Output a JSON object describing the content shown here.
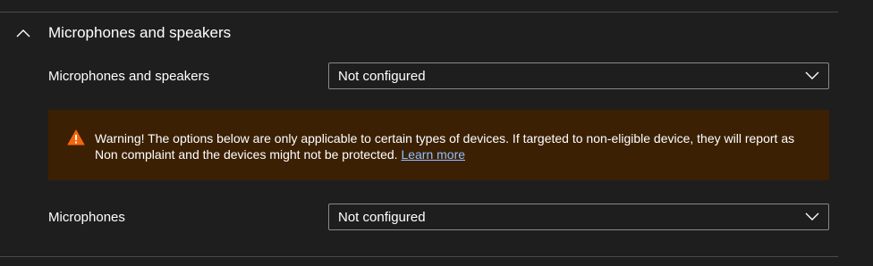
{
  "section": {
    "title": "Microphones and speakers",
    "icon": "chevron-up-icon"
  },
  "settings": [
    {
      "label": "Microphones and speakers",
      "value": "Not configured"
    },
    {
      "label": "Microphones",
      "value": "Not configured"
    }
  ],
  "warning": {
    "icon": "warning-icon",
    "text": "Warning! The options below are only applicable to certain types of devices. If targeted to non-eligible device, they will report as Non complaint and the devices might not be protected.",
    "link_label": "Learn more"
  },
  "colors": {
    "background": "#1f1e1e",
    "warning_background": "#3b2003",
    "warning_icon": "#f7630c",
    "link": "#8fc1ff",
    "border": "#8a8886"
  }
}
